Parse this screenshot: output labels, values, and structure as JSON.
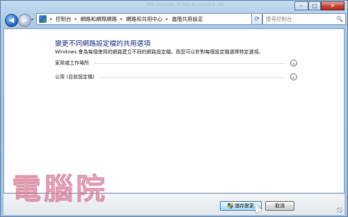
{
  "titlebar": {
    "faint_text": "NPL (Internet, 2) Net Accessed 4..AM",
    "controls": {
      "minimize": "–",
      "maximize": "□",
      "close": "✕"
    }
  },
  "navbar": {
    "back_icon": "◀",
    "forward_icon": "▶",
    "history_icon": "▾",
    "breadcrumb": [
      "控制台",
      "網路和網際網路",
      "網路和共用中心",
      "進階共用設定"
    ],
    "separator": "▸",
    "dropdown_icon": "▾",
    "refresh_icon": "⟳",
    "search_placeholder": "搜尋控制台",
    "search_icon": "🔍"
  },
  "main": {
    "heading": "變更不同網路設定檔的共用選項",
    "description": "Windows 會為每個使用的網路建立不同的網路設定檔。而您可以針對每個設定檔選擇特定選項。",
    "sections": [
      {
        "label": "家用或工作場所",
        "expander_icon": "⌄"
      },
      {
        "label": "公用 (目前設定檔)",
        "expander_icon": "⌄"
      }
    ]
  },
  "footer": {
    "save_label": "儲存變更",
    "cancel_label": "取消"
  },
  "watermark": "電腦院"
}
